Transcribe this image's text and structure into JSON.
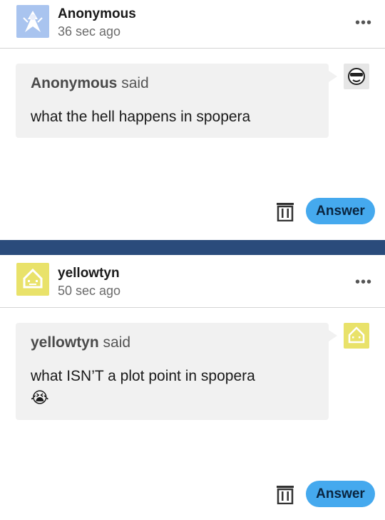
{
  "posts": [
    {
      "author": "Anonymous",
      "time_ago": "36 sec ago",
      "asker": "Anonymous",
      "said_label": "said",
      "question": "what the hell happens in spopera",
      "emoji": "",
      "answer_label": "Answer",
      "avatar_icon": "anonymous-ghost-icon",
      "side_avatar_icon": "sunglasses-face-icon"
    },
    {
      "author": "yellowtyn",
      "time_ago": "50 sec ago",
      "asker": "yellowtyn",
      "said_label": "said",
      "question": "what ISN’T a plot point in spopera",
      "emoji": "😭",
      "answer_label": "Answer",
      "avatar_icon": "yellow-pixel-sprite-icon",
      "side_avatar_icon": "yellow-pixel-sprite-icon"
    }
  ],
  "colors": {
    "accent_button": "#45a9ee",
    "divider": "#2a4b7b",
    "bubble": "#f1f1f1",
    "yellow_avatar": "#e9e26a"
  }
}
